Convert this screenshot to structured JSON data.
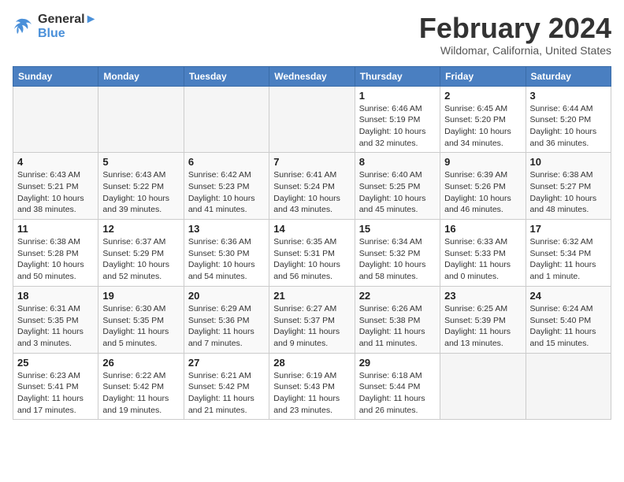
{
  "header": {
    "logo_line1": "General",
    "logo_line2": "Blue",
    "month_title": "February 2024",
    "location": "Wildomar, California, United States"
  },
  "weekdays": [
    "Sunday",
    "Monday",
    "Tuesday",
    "Wednesday",
    "Thursday",
    "Friday",
    "Saturday"
  ],
  "weeks": [
    [
      {
        "day": "",
        "info": ""
      },
      {
        "day": "",
        "info": ""
      },
      {
        "day": "",
        "info": ""
      },
      {
        "day": "",
        "info": ""
      },
      {
        "day": "1",
        "info": "Sunrise: 6:46 AM\nSunset: 5:19 PM\nDaylight: 10 hours\nand 32 minutes."
      },
      {
        "day": "2",
        "info": "Sunrise: 6:45 AM\nSunset: 5:20 PM\nDaylight: 10 hours\nand 34 minutes."
      },
      {
        "day": "3",
        "info": "Sunrise: 6:44 AM\nSunset: 5:20 PM\nDaylight: 10 hours\nand 36 minutes."
      }
    ],
    [
      {
        "day": "4",
        "info": "Sunrise: 6:43 AM\nSunset: 5:21 PM\nDaylight: 10 hours\nand 38 minutes."
      },
      {
        "day": "5",
        "info": "Sunrise: 6:43 AM\nSunset: 5:22 PM\nDaylight: 10 hours\nand 39 minutes."
      },
      {
        "day": "6",
        "info": "Sunrise: 6:42 AM\nSunset: 5:23 PM\nDaylight: 10 hours\nand 41 minutes."
      },
      {
        "day": "7",
        "info": "Sunrise: 6:41 AM\nSunset: 5:24 PM\nDaylight: 10 hours\nand 43 minutes."
      },
      {
        "day": "8",
        "info": "Sunrise: 6:40 AM\nSunset: 5:25 PM\nDaylight: 10 hours\nand 45 minutes."
      },
      {
        "day": "9",
        "info": "Sunrise: 6:39 AM\nSunset: 5:26 PM\nDaylight: 10 hours\nand 46 minutes."
      },
      {
        "day": "10",
        "info": "Sunrise: 6:38 AM\nSunset: 5:27 PM\nDaylight: 10 hours\nand 48 minutes."
      }
    ],
    [
      {
        "day": "11",
        "info": "Sunrise: 6:38 AM\nSunset: 5:28 PM\nDaylight: 10 hours\nand 50 minutes."
      },
      {
        "day": "12",
        "info": "Sunrise: 6:37 AM\nSunset: 5:29 PM\nDaylight: 10 hours\nand 52 minutes."
      },
      {
        "day": "13",
        "info": "Sunrise: 6:36 AM\nSunset: 5:30 PM\nDaylight: 10 hours\nand 54 minutes."
      },
      {
        "day": "14",
        "info": "Sunrise: 6:35 AM\nSunset: 5:31 PM\nDaylight: 10 hours\nand 56 minutes."
      },
      {
        "day": "15",
        "info": "Sunrise: 6:34 AM\nSunset: 5:32 PM\nDaylight: 10 hours\nand 58 minutes."
      },
      {
        "day": "16",
        "info": "Sunrise: 6:33 AM\nSunset: 5:33 PM\nDaylight: 11 hours\nand 0 minutes."
      },
      {
        "day": "17",
        "info": "Sunrise: 6:32 AM\nSunset: 5:34 PM\nDaylight: 11 hours\nand 1 minute."
      }
    ],
    [
      {
        "day": "18",
        "info": "Sunrise: 6:31 AM\nSunset: 5:35 PM\nDaylight: 11 hours\nand 3 minutes."
      },
      {
        "day": "19",
        "info": "Sunrise: 6:30 AM\nSunset: 5:35 PM\nDaylight: 11 hours\nand 5 minutes."
      },
      {
        "day": "20",
        "info": "Sunrise: 6:29 AM\nSunset: 5:36 PM\nDaylight: 11 hours\nand 7 minutes."
      },
      {
        "day": "21",
        "info": "Sunrise: 6:27 AM\nSunset: 5:37 PM\nDaylight: 11 hours\nand 9 minutes."
      },
      {
        "day": "22",
        "info": "Sunrise: 6:26 AM\nSunset: 5:38 PM\nDaylight: 11 hours\nand 11 minutes."
      },
      {
        "day": "23",
        "info": "Sunrise: 6:25 AM\nSunset: 5:39 PM\nDaylight: 11 hours\nand 13 minutes."
      },
      {
        "day": "24",
        "info": "Sunrise: 6:24 AM\nSunset: 5:40 PM\nDaylight: 11 hours\nand 15 minutes."
      }
    ],
    [
      {
        "day": "25",
        "info": "Sunrise: 6:23 AM\nSunset: 5:41 PM\nDaylight: 11 hours\nand 17 minutes."
      },
      {
        "day": "26",
        "info": "Sunrise: 6:22 AM\nSunset: 5:42 PM\nDaylight: 11 hours\nand 19 minutes."
      },
      {
        "day": "27",
        "info": "Sunrise: 6:21 AM\nSunset: 5:42 PM\nDaylight: 11 hours\nand 21 minutes."
      },
      {
        "day": "28",
        "info": "Sunrise: 6:19 AM\nSunset: 5:43 PM\nDaylight: 11 hours\nand 23 minutes."
      },
      {
        "day": "29",
        "info": "Sunrise: 6:18 AM\nSunset: 5:44 PM\nDaylight: 11 hours\nand 26 minutes."
      },
      {
        "day": "",
        "info": ""
      },
      {
        "day": "",
        "info": ""
      }
    ]
  ]
}
